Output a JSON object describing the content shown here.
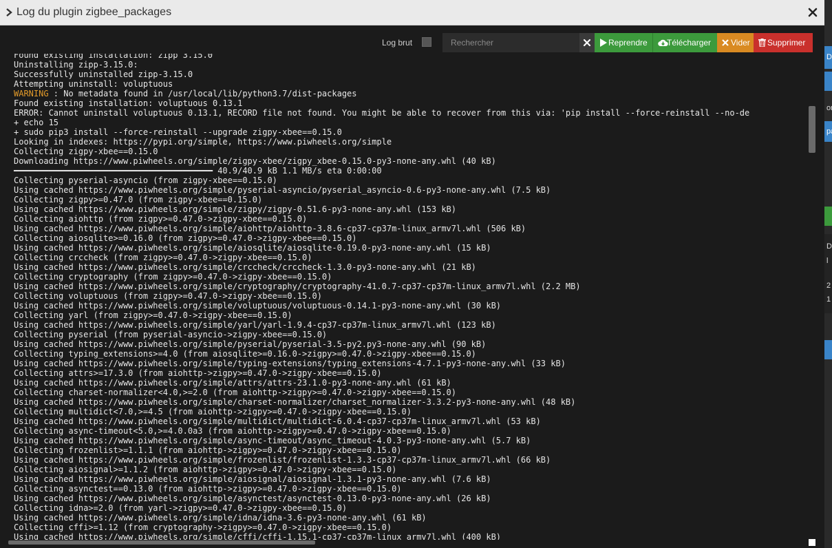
{
  "dialog": {
    "title": "Log du plugin zigbee_packages"
  },
  "toolbar": {
    "raw_log_label": "Log brut",
    "search_placeholder": "Rechercher",
    "resume_label": "Reprendre",
    "download_label": "Télécharger",
    "empty_label": "Vider",
    "delete_label": "Supprimer"
  },
  "background": {
    "snippets": [
      "Dé",
      "on",
      "pa",
      "D",
      "l",
      "2",
      "1"
    ]
  },
  "colors": {
    "green": "#3c9a3c",
    "orange": "#d98a22",
    "red": "#c9302c",
    "warning": "#e39b2a",
    "log_background": "#1b1b1b"
  },
  "log": {
    "warning_tag": "WARNING",
    "lines_before": [
      "Found existing installation: zipp 3.15.0",
      "Uninstalling zipp-3.15.0:",
      "Successfully uninstalled zipp-3.15.0",
      "Attempting uninstall: voluptuous"
    ],
    "warning_message": " : No metadata found in /usr/local/lib/python3.7/dist-packages",
    "lines_after": [
      "Found existing installation: voluptuous 0.13.1",
      "ERROR: Cannot uninstall voluptuous 0.13.1, RECORD file not found. You might be able to recover from this via: 'pip install --force-reinstall --no-de",
      "+ echo 15",
      "+ sudo pip3 install --force-reinstall --upgrade zigpy-xbee==0.15.0",
      "Looking in indexes: https://pypi.org/simple, https://www.piwheels.org/simple",
      "Collecting zigpy-xbee==0.15.0",
      "Downloading https://www.piwheels.org/simple/zigpy-xbee/zigpy_xbee-0.15.0-py3-none-any.whl (40 kB)",
      "━━━━━━━━━━━━━━━━━━━━━━━━━━━━━━━━━━━━━━━━ 40.9/40.9 kB 1.1 MB/s eta 0:00:00",
      "Collecting pyserial-asyncio (from zigpy-xbee==0.15.0)",
      "Using cached https://www.piwheels.org/simple/pyserial-asyncio/pyserial_asyncio-0.6-py3-none-any.whl (7.5 kB)",
      "Collecting zigpy>=0.47.0 (from zigpy-xbee==0.15.0)",
      "Using cached https://www.piwheels.org/simple/zigpy/zigpy-0.51.6-py3-none-any.whl (153 kB)",
      "Collecting aiohttp (from zigpy>=0.47.0->zigpy-xbee==0.15.0)",
      "Using cached https://www.piwheels.org/simple/aiohttp/aiohttp-3.8.6-cp37-cp37m-linux_armv7l.whl (506 kB)",
      "Collecting aiosqlite>=0.16.0 (from zigpy>=0.47.0->zigpy-xbee==0.15.0)",
      "Using cached https://www.piwheels.org/simple/aiosqlite/aiosqlite-0.19.0-py3-none-any.whl (15 kB)",
      "Collecting crccheck (from zigpy>=0.47.0->zigpy-xbee==0.15.0)",
      "Using cached https://www.piwheels.org/simple/crccheck/crccheck-1.3.0-py3-none-any.whl (21 kB)",
      "Collecting cryptography (from zigpy>=0.47.0->zigpy-xbee==0.15.0)",
      "Using cached https://www.piwheels.org/simple/cryptography/cryptography-41.0.7-cp37-cp37m-linux_armv7l.whl (2.2 MB)",
      "Collecting voluptuous (from zigpy>=0.47.0->zigpy-xbee==0.15.0)",
      "Using cached https://www.piwheels.org/simple/voluptuous/voluptuous-0.14.1-py3-none-any.whl (30 kB)",
      "Collecting yarl (from zigpy>=0.47.0->zigpy-xbee==0.15.0)",
      "Using cached https://www.piwheels.org/simple/yarl/yarl-1.9.4-cp37-cp37m-linux_armv7l.whl (123 kB)",
      "Collecting pyserial (from pyserial-asyncio->zigpy-xbee==0.15.0)",
      "Using cached https://www.piwheels.org/simple/pyserial/pyserial-3.5-py2.py3-none-any.whl (90 kB)",
      "Collecting typing_extensions>=4.0 (from aiosqlite>=0.16.0->zigpy>=0.47.0->zigpy-xbee==0.15.0)",
      "Using cached https://www.piwheels.org/simple/typing-extensions/typing_extensions-4.7.1-py3-none-any.whl (33 kB)",
      "Collecting attrs>=17.3.0 (from aiohttp->zigpy>=0.47.0->zigpy-xbee==0.15.0)",
      "Using cached https://www.piwheels.org/simple/attrs/attrs-23.1.0-py3-none-any.whl (61 kB)",
      "Collecting charset-normalizer<4.0,>=2.0 (from aiohttp->zigpy>=0.47.0->zigpy-xbee==0.15.0)",
      "Using cached https://www.piwheels.org/simple/charset-normalizer/charset_normalizer-3.3.2-py3-none-any.whl (48 kB)",
      "Collecting multidict<7.0,>=4.5 (from aiohttp->zigpy>=0.47.0->zigpy-xbee==0.15.0)",
      "Using cached https://www.piwheels.org/simple/multidict/multidict-6.0.4-cp37-cp37m-linux_armv7l.whl (53 kB)",
      "Collecting async-timeout<5.0,>=4.0.0a3 (from aiohttp->zigpy>=0.47.0->zigpy-xbee==0.15.0)",
      "Using cached https://www.piwheels.org/simple/async-timeout/async_timeout-4.0.3-py3-none-any.whl (5.7 kB)",
      "Collecting frozenlist>=1.1.1 (from aiohttp->zigpy>=0.47.0->zigpy-xbee==0.15.0)",
      "Using cached https://www.piwheels.org/simple/frozenlist/frozenlist-1.3.3-cp37-cp37m-linux_armv7l.whl (66 kB)",
      "Collecting aiosignal>=1.1.2 (from aiohttp->zigpy>=0.47.0->zigpy-xbee==0.15.0)",
      "Using cached https://www.piwheels.org/simple/aiosignal/aiosignal-1.3.1-py3-none-any.whl (7.6 kB)",
      "Collecting asynctest==0.13.0 (from aiohttp->zigpy>=0.47.0->zigpy-xbee==0.15.0)",
      "Using cached https://www.piwheels.org/simple/asynctest/asynctest-0.13.0-py3-none-any.whl (26 kB)",
      "Collecting idna>=2.0 (from yarl->zigpy>=0.47.0->zigpy-xbee==0.15.0)",
      "Using cached https://www.piwheels.org/simple/idna/idna-3.6-py3-none-any.whl (61 kB)",
      "Collecting cffi>=1.12 (from cryptography->zigpy>=0.47.0->zigpy-xbee==0.15.0)",
      "Using cached https://www.piwheels.org/simple/cffi/cffi-1.15.1-cp37-cp37m-linux_armv7l.whl (400 kB)"
    ]
  }
}
